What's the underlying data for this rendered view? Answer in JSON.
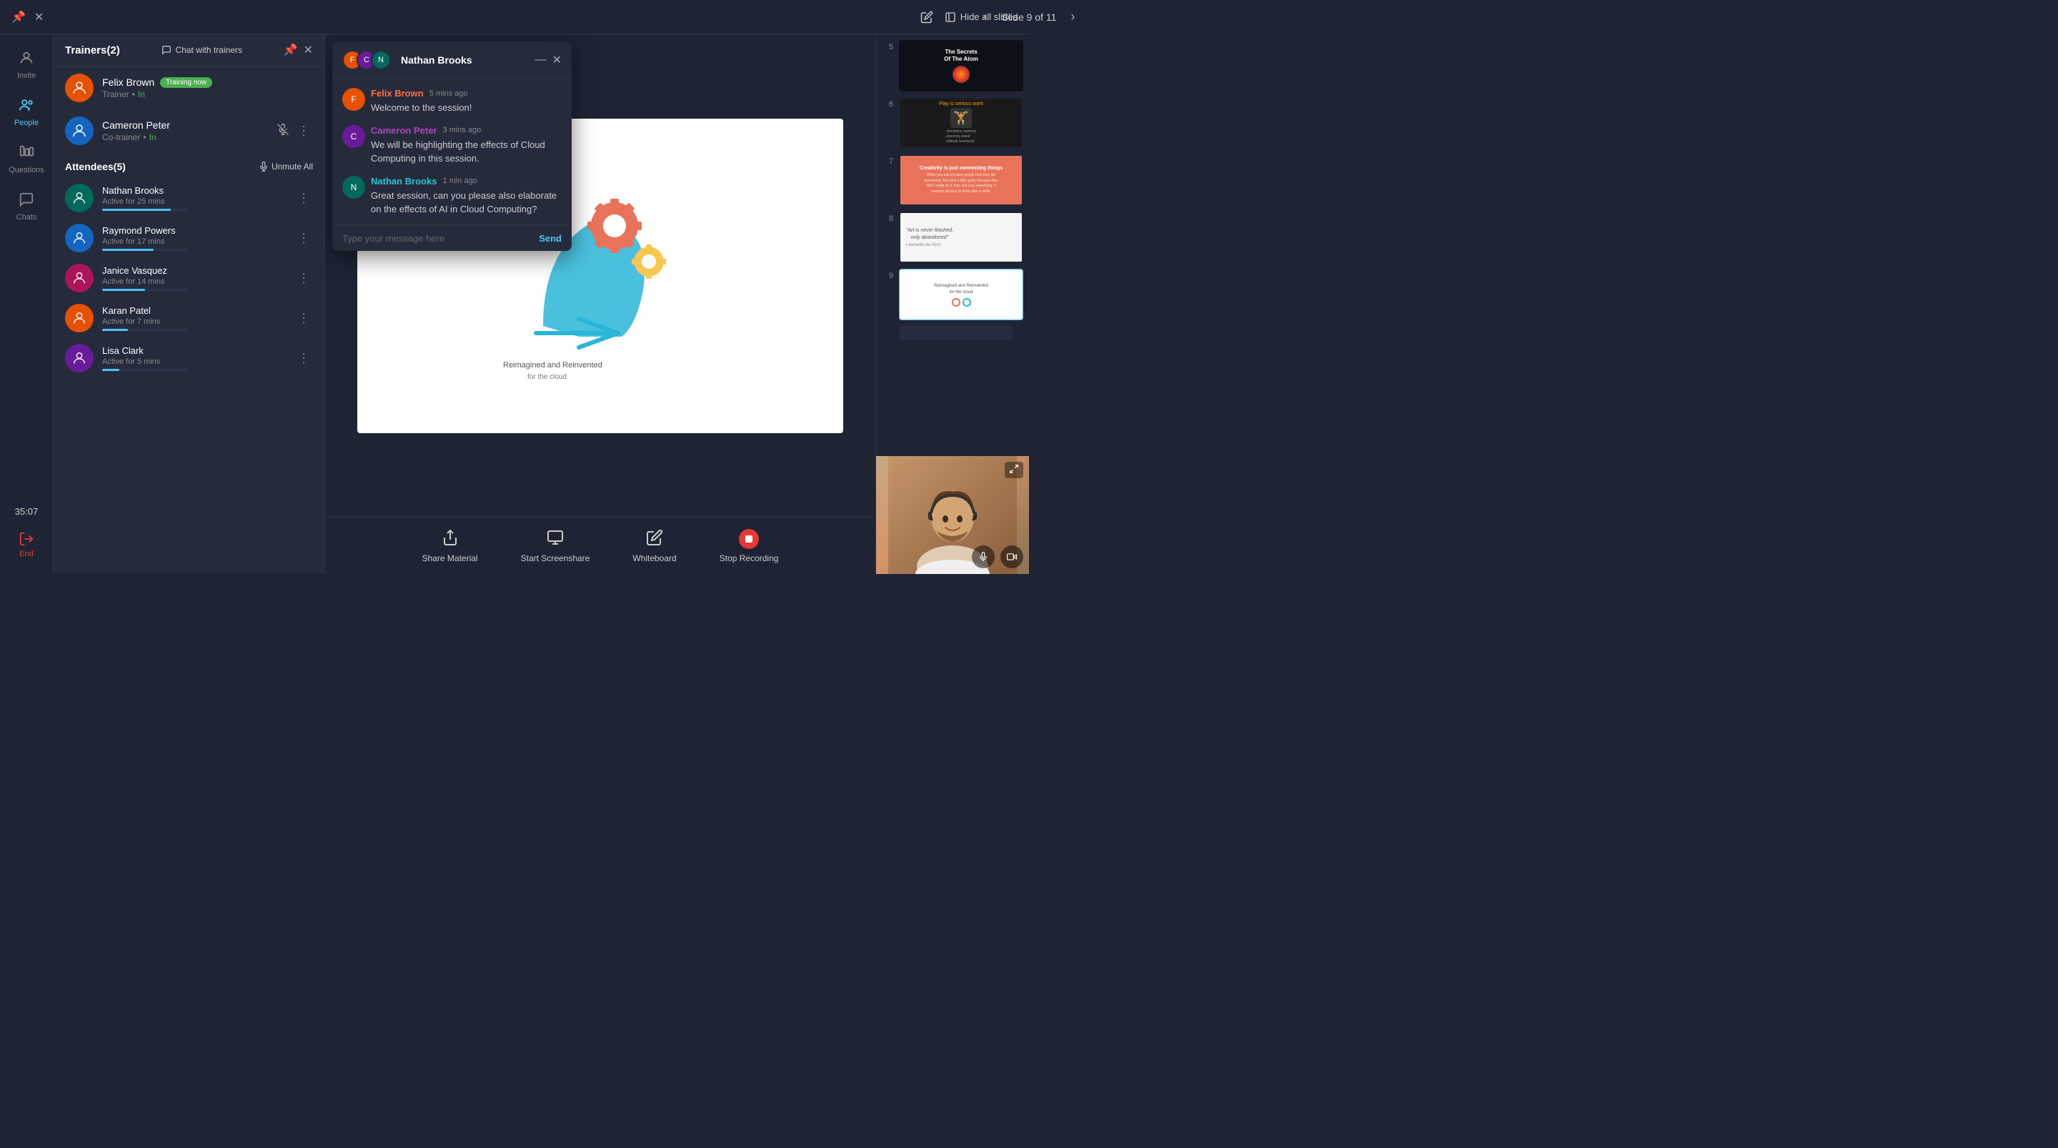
{
  "topBar": {
    "slideLabel": "Slide 9 of 11",
    "hideSlidesBtn": "Hide all slides",
    "editIconTitle": "Edit"
  },
  "sidebar": {
    "items": [
      {
        "id": "invite",
        "label": "Invite",
        "icon": "👤"
      },
      {
        "id": "people",
        "label": "People",
        "icon": "👥",
        "active": true
      },
      {
        "id": "questions",
        "label": "Questions",
        "icon": "📊"
      },
      {
        "id": "chats",
        "label": "Chats",
        "icon": "💬"
      }
    ],
    "timer": "35:07",
    "endLabel": "End"
  },
  "peoplePanel": {
    "trainersTitle": "Trainers(2)",
    "chatWithTrainersBtn": "Chat with trainers",
    "trainers": [
      {
        "name": "Felix Brown",
        "role": "Trainer",
        "status": "In",
        "badge": "Training now"
      },
      {
        "name": "Cameron Peter",
        "role": "Co-trainer",
        "status": "In"
      }
    ],
    "attendeesTitle": "Attendees(5)",
    "unmuteAllBtn": "Unmute All",
    "attendees": [
      {
        "name": "Nathan Brooks",
        "status": "Active for 25 mins",
        "progress": 80
      },
      {
        "name": "Raymond Powers",
        "status": "Active for 17 mins",
        "progress": 60
      },
      {
        "name": "Janice Vasquez",
        "status": "Active for 14 mins",
        "progress": 50
      },
      {
        "name": "Karan Patel",
        "status": "Active for 7 mins",
        "progress": 30
      },
      {
        "name": "Lisa Clark",
        "status": "Active for 5 mins",
        "progress": 20
      }
    ]
  },
  "chat": {
    "title": "Nathan Brooks",
    "messages": [
      {
        "sender": "Felix Brown",
        "senderClass": "felix",
        "time": "5 mins ago",
        "text": "Welcome to the session!"
      },
      {
        "sender": "Cameron Peter",
        "senderClass": "cameron",
        "time": "3 mins ago",
        "text": "We will be highlighting the effects of Cloud Computing in this session."
      },
      {
        "sender": "Nathan Brooks",
        "senderClass": "nathan",
        "time": "1 min ago",
        "text": "Great session, can you please also elaborate on the effects of AI in Cloud Computing?"
      }
    ],
    "inputPlaceholder": "Type your message here",
    "sendBtn": "Send"
  },
  "slides": [
    {
      "num": "5",
      "label": "Secrets Of The Atom",
      "theme": "thumb-5"
    },
    {
      "num": "6",
      "label": "Play is serious work",
      "theme": "thumb-6"
    },
    {
      "num": "7",
      "label": "Creativity is just connecting things",
      "theme": "thumb-7"
    },
    {
      "num": "8",
      "label": "Art is never finished, only abandoned",
      "theme": "thumb-8"
    },
    {
      "num": "9",
      "label": "Reimagined and Reinvented for the cloud",
      "theme": "thumb-9",
      "active": true
    }
  ],
  "toolbar": {
    "shareMaterial": "Share Material",
    "startScreenshare": "Start Screenshare",
    "whiteboard": "Whiteboard",
    "stopRecording": "Stop Recording"
  },
  "slideContent": {
    "textLine1": "Reimagined",
    "textLine2": "and Reinvented"
  }
}
